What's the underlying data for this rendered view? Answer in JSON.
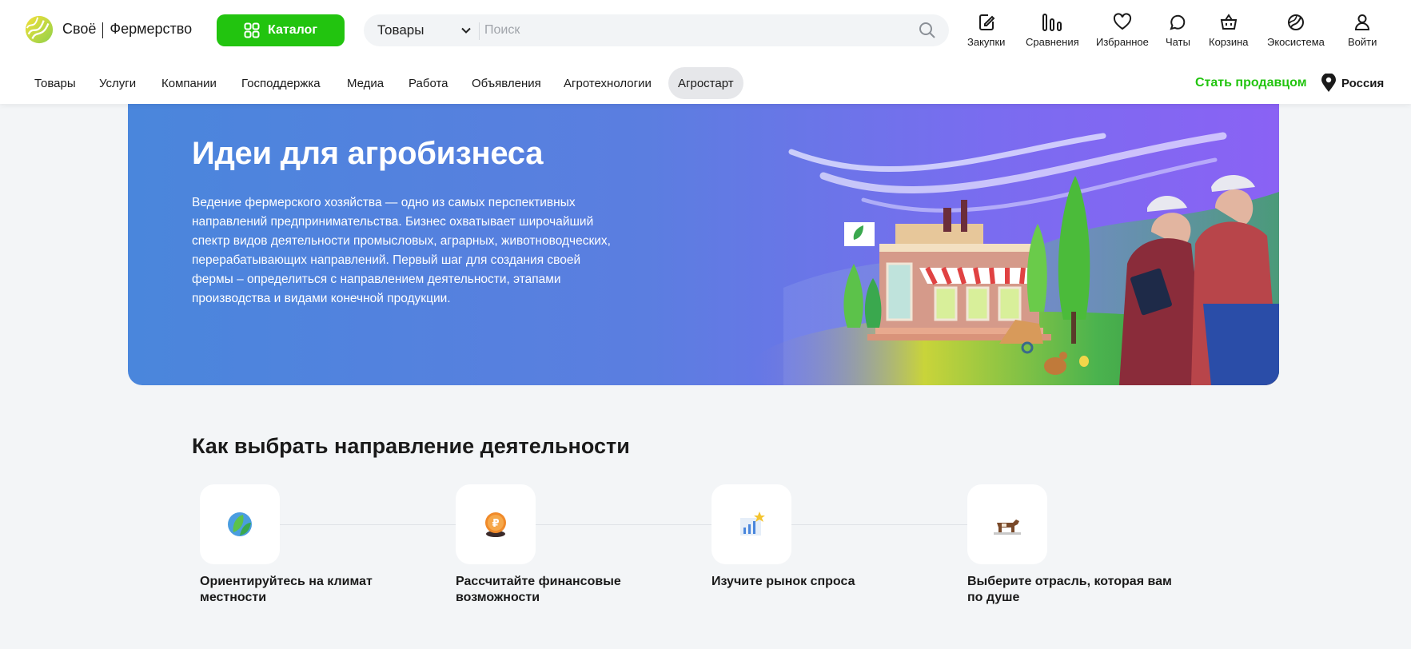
{
  "logo": {
    "brand_left": "Своё",
    "brand_right": "Фермерство"
  },
  "catalog": {
    "label": "Каталог"
  },
  "search": {
    "category": "Товары",
    "placeholder": "Поиск"
  },
  "top_icons": [
    {
      "label": "Закупки",
      "icon": "edit-document-icon"
    },
    {
      "label": "Сравнения",
      "icon": "compare-bars-icon"
    },
    {
      "label": "Избранное",
      "icon": "heart-icon"
    },
    {
      "label": "Чаты",
      "icon": "chat-bubble-icon"
    },
    {
      "label": "Корзина",
      "icon": "basket-icon"
    },
    {
      "label": "Экосистема",
      "icon": "ecosystem-icon"
    },
    {
      "label": "Войти",
      "icon": "user-icon"
    }
  ],
  "nav": [
    "Товары",
    "Услуги",
    "Компании",
    "Господдержка",
    "Медиа",
    "Работа",
    "Объявления",
    "Агротехнологии",
    "Агростарт"
  ],
  "nav_active": "Агростарт",
  "become_seller": "Стать продавцом",
  "region": "Россия",
  "hero": {
    "title": "Идеи для агробизнеса",
    "text": "Ведение фермерского хозяйства — одно из самых перспективных направлений предпринимательства. Бизнес охватывает широчайший спектр видов деятельности промысловых, аграрных, животноводческих, перерабатывающих направлений. Первый шаг для создания своей фермы – определиться с направлением деятельности, этапами производства и видами конечной продукции."
  },
  "section": {
    "title": "Как выбрать направление деятельности",
    "steps": [
      {
        "label": "Ориентируйтесь на климат местности",
        "icon": "globe-leaf-icon"
      },
      {
        "label": "Рассчитайте финансовые возможности",
        "icon": "ruble-coin-icon"
      },
      {
        "label": "Изучите рынок спроса",
        "icon": "chart-star-icon"
      },
      {
        "label": "Выберите отрасль, которая вам по душе",
        "icon": "cow-icon"
      }
    ]
  },
  "colors": {
    "accent_green": "#22c40f",
    "hero_start": "#4a86dc",
    "hero_end": "#8a62f4",
    "background": "#f3f5f7"
  }
}
